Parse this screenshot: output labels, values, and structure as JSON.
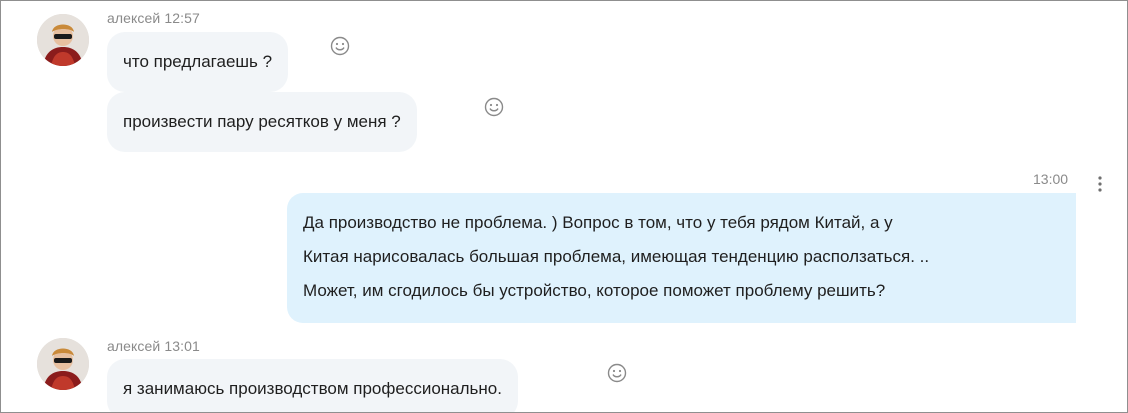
{
  "messages": [
    {
      "sender_time": "алексей 12:57",
      "avatar_icon": "user-avatar-icon"
    },
    {
      "text": "что предлагаешь ?"
    },
    {
      "text": "произвести пару ресятков у меня ?"
    },
    {
      "time": "13:00",
      "lines": [
        "Да производство не проблема. )  Вопрос в том, что у тебя рядом Китай, а у",
        "Китая нарисовалась большая проблема, имеющая тенденцию расползаться. ..",
        "Может, им сгодилось бы устройство, которое поможет проблему решить?"
      ]
    },
    {
      "sender_time": "алексей 13:01",
      "avatar_icon": "user-avatar-icon"
    },
    {
      "text": "я занимаюсь производством профессионально."
    }
  ],
  "icons": {
    "reaction": "smiley-reaction-icon",
    "more": "more-options-icon"
  },
  "colors": {
    "incoming_bubble": "#f2f5f8",
    "outgoing_bubble": "#dff2fd",
    "meta_text": "#8a8a8a"
  }
}
